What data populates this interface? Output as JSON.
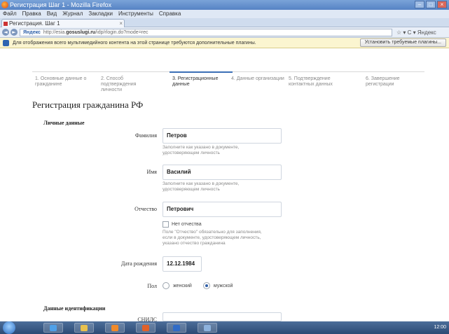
{
  "window": {
    "title": "Регистрация Шаг 1 - Mozilla Firefox",
    "min": "–",
    "max": "□",
    "close": "×"
  },
  "menu": [
    "Файл",
    "Правка",
    "Вид",
    "Журнал",
    "Закладки",
    "Инструменты",
    "Справка"
  ],
  "tab": {
    "label": "Регистрация. Шаг 1",
    "close": "×"
  },
  "nav": {
    "back": "◄",
    "forward": "►",
    "site_identity": "Яндекс",
    "url_prefix": "http://esia.",
    "url_domain": "gosuslugi.ru",
    "url_rest": "/idp/rlogin.do?mode=rec",
    "right_controls": "☆ ▾ C ▾ Яндекс"
  },
  "plugin_bar": {
    "message": "Для отображения всего мультимедийного контента на этой странице требуются дополнительные плагины.",
    "button": "Установить требуемые плагины..."
  },
  "steps": [
    {
      "label": "1. Основные данные о гражданине"
    },
    {
      "label": "2. Способ подтверждения личности"
    },
    {
      "label": "3. Регистрационные данные",
      "active": true
    },
    {
      "label": "4. Данные организации"
    },
    {
      "label": "5. Подтверждение контактных данных"
    },
    {
      "label": "6. Завершение регистрации"
    }
  ],
  "form": {
    "title": "Регистрация гражданина РФ",
    "personal_section": "Личные данные",
    "surname": {
      "label": "Фамилия",
      "value": "Петров",
      "hint": "Заполните как указано в документе, удостоверяющем личность"
    },
    "name": {
      "label": "Имя",
      "value": "Василий",
      "hint": "Заполните как указано в документе, удостоверяющем личность"
    },
    "patronymic": {
      "label": "Отчество",
      "value": "Петрович",
      "no_patronymic": "Нет отчества",
      "hint": "Поле \"Отчество\" обязательно для заполнения, если в документе, удостоверяющем личность, указано отчество гражданина"
    },
    "birthdate": {
      "label": "Дата рождения",
      "value": "12.12.1984"
    },
    "gender": {
      "label": "Пол",
      "female": "женский",
      "male": "мужской",
      "selected": "male"
    },
    "id_section": "Данные идентификации",
    "snils": {
      "label": "СНИЛС",
      "value": ""
    }
  },
  "tray": {
    "time": "12:00"
  },
  "colors": {
    "accent": "#3b6fb6",
    "plugin_bar": "#fbf5d0",
    "taskbar": "#2b4a74"
  }
}
